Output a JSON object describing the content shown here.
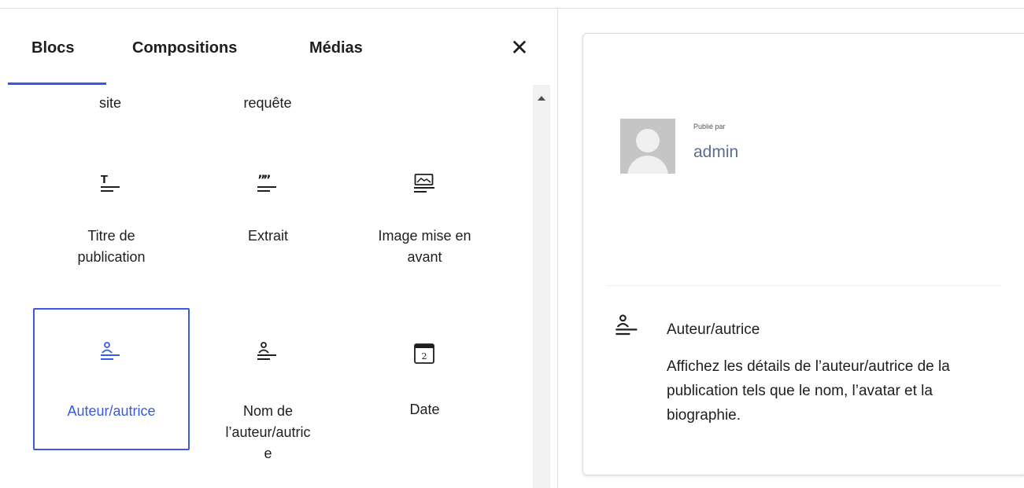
{
  "tabs": [
    {
      "label": "Blocs",
      "active": true
    },
    {
      "label": "Compositions",
      "active": false
    },
    {
      "label": "Médias",
      "active": false
    }
  ],
  "close_glyph": "✕",
  "accent_color": "#3858e9",
  "blocks": {
    "partial_row": [
      "site",
      "requête"
    ],
    "row1": [
      {
        "label_lines": [
          "Titre de",
          "publication"
        ],
        "icon": "post-title-icon"
      },
      {
        "label_lines": [
          "Extrait"
        ],
        "icon": "post-excerpt-icon"
      },
      {
        "label_lines": [
          "Image mise en",
          "avant"
        ],
        "icon": "featured-image-icon"
      }
    ],
    "row2": [
      {
        "label_lines": [
          "Auteur/autrice"
        ],
        "icon": "post-author-icon",
        "selected": true
      },
      {
        "label_lines": [
          "Nom de",
          "l’auteur/autric",
          "e"
        ],
        "icon": "post-author-name-icon"
      },
      {
        "label_lines": [
          "Date"
        ],
        "icon": "post-date-icon",
        "icon_text": "2"
      }
    ]
  },
  "preview": {
    "published_by": "Publié par",
    "author_name": "admin",
    "block_title": "Auteur/autrice",
    "block_description": "Affichez les détails de l’auteur/autrice de la publication tels que le nom, l’avatar et la biographie."
  }
}
